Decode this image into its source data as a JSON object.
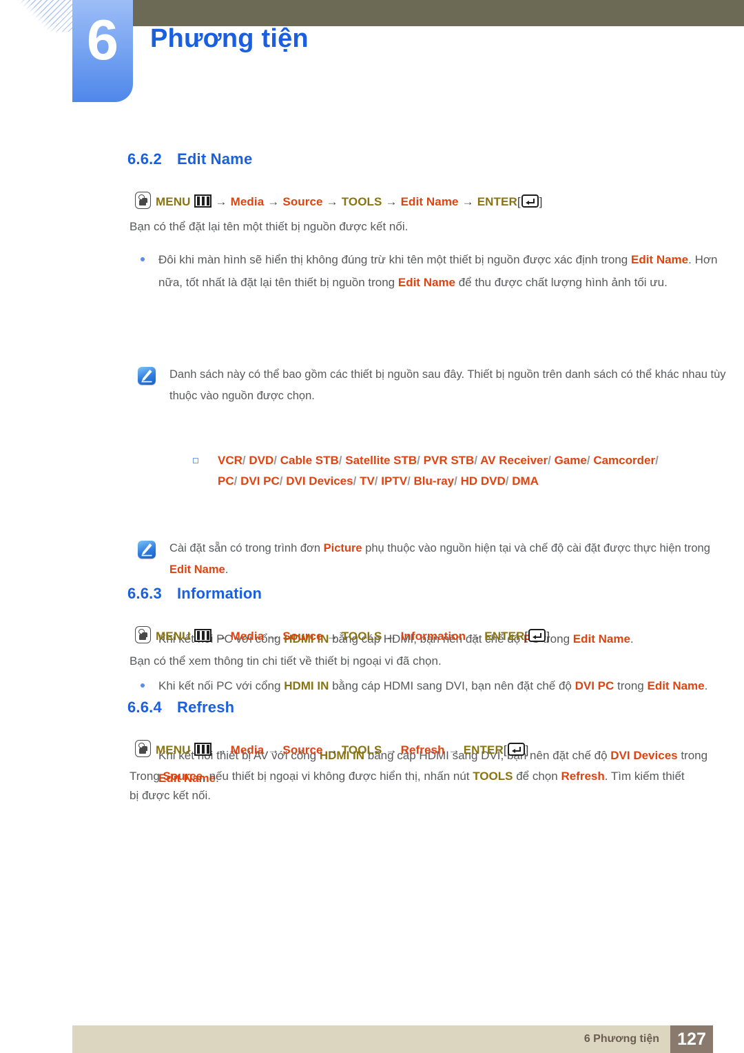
{
  "header": {
    "chapter_number": "6",
    "chapter_title": "Phương tiện"
  },
  "footer": {
    "label": "6 Phương tiện",
    "page_number": "127"
  },
  "sections": [
    {
      "number": "6.6.2",
      "title": "Edit Name",
      "menupath": {
        "menu": "MENU",
        "arrow": "→",
        "step1": "Media",
        "step2": "Source",
        "step3": "TOOLS",
        "step4": "Edit Name",
        "enter": "ENTER",
        "bracket_open": "[",
        "bracket_close": "]"
      },
      "intro": "Bạn có thể đặt lại tên một thiết bị nguồn được kết nối."
    },
    {
      "number": "6.6.3",
      "title": "Information",
      "menupath": {
        "menu": "MENU",
        "step1": "Media",
        "step2": "Source",
        "step3": "TOOLS",
        "step4": "Information",
        "enter": "ENTER"
      },
      "intro": "Bạn có thể xem thông tin chi tiết về thiết bị ngoại vi đã chọn."
    },
    {
      "number": "6.6.4",
      "title": "Refresh",
      "menupath": {
        "menu": "MENU",
        "step1": "Media",
        "step2": "Source",
        "step3": "TOOLS",
        "step4": "Refresh",
        "enter": "ENTER"
      }
    }
  ],
  "bullets": {
    "b1": {
      "t1": "Đôi khi màn hình sẽ hiển thị không đúng trừ khi tên một thiết bị nguồn được xác định trong ",
      "hl1": "Edit Name",
      "t2": ". Hơn nữa, tốt nhất là đặt lại tên thiết bị nguồn trong ",
      "hl2": "Edit Name",
      "t3": " để thu được chất lượng hình ảnh tối ưu."
    },
    "b2": {
      "t1": "Khi kết nối PC với cổng ",
      "hl1": "HDMI IN",
      "t2": " bằng cáp HDMI, bạn nên đặt chế độ ",
      "hl2": "PC",
      "t3": " trong ",
      "hl3": "Edit Name",
      "t4": "."
    },
    "b3": {
      "t1": "Khi kết nối PC với cổng ",
      "hl1": "HDMI IN",
      "t2": " bằng cáp HDMI sang DVI, bạn nên đặt chế độ ",
      "hl2": "DVI PC",
      "t3": " trong ",
      "hl3": "Edit Name",
      "t4": "."
    },
    "b4": {
      "t1": "Khi kết nối thiết bị AV với cổng ",
      "hl1": "HDMI IN",
      "t2": " bằng cáp HDMI sang DVI, bạn nên đặt chế độ ",
      "hl2": "DVI Devices",
      "t3": " trong ",
      "hl3": "Edit Name",
      "t4": "."
    }
  },
  "notes": {
    "n1": "Danh sách này có thể bao gồm các thiết bị nguồn sau đây. Thiết bị nguồn trên danh sách có thể khác nhau tùy thuộc vào nguồn được chọn.",
    "n2": {
      "t1": "Cài đặt sẵn có trong trình đơn ",
      "hl1": "Picture",
      "t2": " phụ thuộc vào nguồn hiện tại và chế độ cài đặt được thực hiện trong ",
      "hl2": "Edit Name",
      "t3": "."
    }
  },
  "device_list": {
    "line1": [
      "VCR",
      "DVD",
      "Cable STB",
      "Satellite STB",
      "PVR STB",
      "AV Receiver",
      "Game",
      "Camcorder"
    ],
    "line2": [
      "PC",
      "DVI PC",
      "DVI Devices",
      "TV",
      "IPTV",
      "Blu-ray",
      "HD DVD",
      "DMA"
    ],
    "separator": "/"
  },
  "refresh_paragraph": {
    "t1": "Trong ",
    "hl1": "Source",
    "t2": ", nếu thiết bị ngoại vi không được hiển thị, nhấn nút ",
    "hl2": "TOOLS",
    "t3": " để chọn ",
    "hl3": "Refresh",
    "t4": ". Tìm kiếm thiết bị được kết nối."
  },
  "colors": {
    "chapter_blue": "#1a5fe0",
    "olive_bar": "#6c6a55",
    "highlight_red": "#dd4411",
    "highlight_olive": "#8a7411",
    "footer_bar": "#dcd5c0",
    "footer_page_box": "#8a7a6e"
  }
}
